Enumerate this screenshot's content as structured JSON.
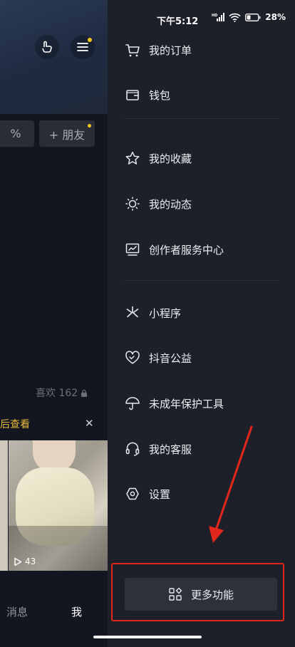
{
  "status_bar": {
    "time": "下午5:12",
    "battery": "28%",
    "network": "HD"
  },
  "background_page": {
    "friend_button": "+ 朋友",
    "partial_button": "%",
    "likes": "喜欢 162",
    "notice": "后查看",
    "close": "✕",
    "video_plays": "43",
    "nav": {
      "messages": "消息",
      "me": "我"
    }
  },
  "drawer": {
    "items": [
      {
        "label": "我的订单",
        "icon": "cart-icon"
      },
      {
        "label": "钱包",
        "icon": "wallet-icon"
      },
      {
        "label": "我的收藏",
        "icon": "star-icon"
      },
      {
        "label": "我的动态",
        "icon": "sun-icon"
      },
      {
        "label": "创作者服务中心",
        "icon": "creator-chart-icon"
      },
      {
        "label": "小程序",
        "icon": "mini-program-icon"
      },
      {
        "label": "抖音公益",
        "icon": "heart-charity-icon"
      },
      {
        "label": "未成年保护工具",
        "icon": "umbrella-icon"
      },
      {
        "label": "我的客服",
        "icon": "headset-icon"
      },
      {
        "label": "设置",
        "icon": "settings-hex-icon"
      }
    ],
    "more_button": "更多功能"
  },
  "colors": {
    "drawer_bg": "#1e2029",
    "highlight_red": "#e1261c",
    "accent_yellow": "#f5c518"
  }
}
